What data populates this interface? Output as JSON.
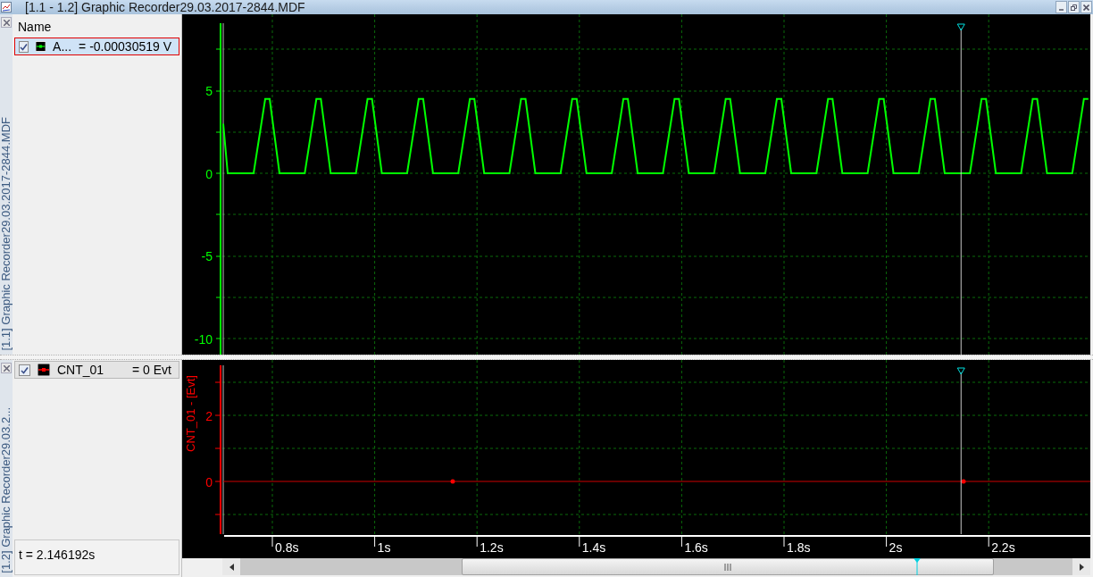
{
  "window": {
    "title": "[1.1 - 1.2] Graphic Recorder29.03.2017-2844.MDF"
  },
  "panes": [
    {
      "tab_label": "[1.1] Graphic Recorder29.03.2017-2844.MDF",
      "list_header": "Name",
      "channels": [
        {
          "name": "A...",
          "value": "= -0.00030519 V",
          "checked": true,
          "selected": true,
          "color": "#00ff00"
        }
      ],
      "y_ticks": [
        "5",
        "0",
        "-5",
        "-10"
      ]
    },
    {
      "tab_label": "[1.2] Graphic Recorder29.03.2...",
      "channels": [
        {
          "name": "CNT_01",
          "value": "= 0 Evt",
          "checked": true,
          "selected": false,
          "color": "#ff0000"
        }
      ],
      "y_axis_title": "CNT_01 - [Evt]",
      "y_ticks": [
        "2",
        "0"
      ],
      "cursor_readout": "t = 2.146192s"
    }
  ],
  "time_axis": {
    "ticks": [
      "0.8s",
      "1s",
      "1.2s",
      "1.4s",
      "1.6s",
      "1.8s",
      "2s",
      "2.2s"
    ]
  }
}
